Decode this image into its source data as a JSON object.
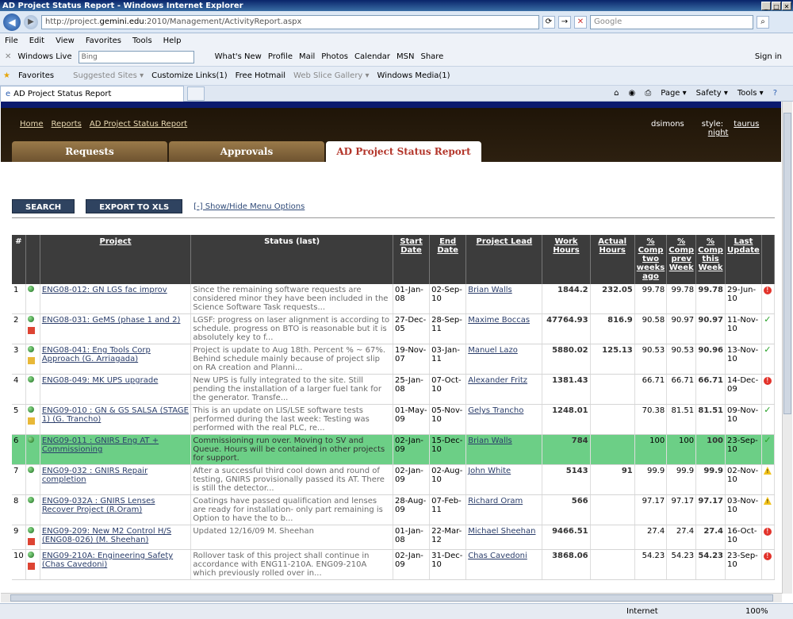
{
  "browser": {
    "title": "AD Project Status Report - Windows Internet Explorer",
    "url_prefix": "http://project.",
    "url_domain": "gemini.edu",
    "url_suffix": ":2010/Management/ActivityReport.aspx",
    "search_placeholder": "Google",
    "tab_title": "AD Project Status Report",
    "zone": "Internet",
    "zoom": "100%"
  },
  "menu": [
    "File",
    "Edit",
    "View",
    "Favorites",
    "Tools",
    "Help"
  ],
  "links": {
    "windows_live": "Windows Live",
    "bing": "Bing",
    "items": [
      "What's New",
      "Profile",
      "Mail",
      "Photos",
      "Calendar",
      "MSN",
      "Share"
    ],
    "signin": "Sign in"
  },
  "favorites": {
    "label": "Favorites",
    "items": [
      "Suggested Sites ▾",
      "Customize Links(1)",
      "Free Hotmail",
      "Web Slice Gallery ▾",
      "Windows Media(1)"
    ]
  },
  "commands": [
    "Page ▾",
    "Safety ▾",
    "Tools ▾"
  ],
  "page": {
    "breadcrumb": [
      "Home",
      "Reports",
      "AD Project Status Report"
    ],
    "user": "dsimons",
    "style_label": "style:",
    "styles": [
      "taurus",
      "night"
    ],
    "tabs": [
      "Requests",
      "Approvals",
      "AD Project Status Report"
    ],
    "search_btn": "SEARCH",
    "export_btn": "EXPORT TO XLS",
    "toggle": "[-] Show/Hide Menu Options"
  },
  "table": {
    "headers": [
      "#",
      "",
      "Project",
      "Status (last)",
      "Start Date",
      "End Date",
      "Project Lead",
      "Work Hours",
      "Actual Hours",
      "% Comp two weeks ago",
      "% Comp prev Week",
      "% Comp this Week",
      "Last Update",
      ""
    ],
    "rows": [
      {
        "n": "1",
        "cal": "",
        "project": "ENG08-012: GN LGS fac improv",
        "status": "Since the remaining software requests are considered minor they have been included in the Science Software Task requests...",
        "start": "01-Jan-08",
        "end": "02-Sep-10",
        "lead": "Brian Walls",
        "work": "1844.2",
        "actual": "232.05",
        "c2": "99.78",
        "cp": "99.78",
        "ct": "99.78",
        "upd": "29-Jun-10",
        "flag": "red",
        "hl": false
      },
      {
        "n": "2",
        "cal": "r",
        "project": "ENG08-031: GeMS (phase 1 and 2)",
        "status": "LGSF: progress on laser alignment is according to schedule. progress on BTO is reasonable but it is absolutely key to f...",
        "start": "27-Dec-05",
        "end": "28-Sep-11",
        "lead": "Maxime Boccas",
        "work": "47764.93",
        "actual": "816.9",
        "c2": "90.58",
        "cp": "90.97",
        "ct": "90.97",
        "upd": "11-Nov-10",
        "flag": "ok",
        "hl": false
      },
      {
        "n": "3",
        "cal": "y",
        "project": "ENG08-041: Eng Tools Corp Approach (G. Arriagada)",
        "status": "Project is update to Aug 18th. Percent % ~ 67%. Behind schedule mainly because of project slip on RA creation and Planni...",
        "start": "19-Nov-07",
        "end": "03-Jan-11",
        "lead": "Manuel Lazo",
        "work": "5880.02",
        "actual": "125.13",
        "c2": "90.53",
        "cp": "90.53",
        "ct": "90.96",
        "upd": "13-Nov-10",
        "flag": "ok",
        "hl": false
      },
      {
        "n": "4",
        "cal": "",
        "project": "ENG08-049: MK UPS upgrade",
        "status": "New UPS is fully integrated to the site. Still pending the installation of a larger fuel tank for the generator. Transfe...",
        "start": "25-Jan-08",
        "end": "07-Oct-10",
        "lead": "Alexander Fritz",
        "work": "1381.43",
        "actual": "",
        "c2": "66.71",
        "cp": "66.71",
        "ct": "66.71",
        "upd": "14-Dec-09",
        "flag": "red",
        "hl": false
      },
      {
        "n": "5",
        "cal": "y",
        "project": "ENG09-010 : GN & GS SALSA (STAGE 1) (G. Trancho)",
        "status": "This is an update on LIS/LSE software tests performed during the last week: Testing was performed with the real PLC, re...",
        "start": "01-May-09",
        "end": "05-Nov-10",
        "lead": "Gelys Trancho",
        "work": "1248.01",
        "actual": "",
        "c2": "70.38",
        "cp": "81.51",
        "ct": "81.51",
        "upd": "09-Nov-10",
        "flag": "ok",
        "hl": false
      },
      {
        "n": "6",
        "cal": "",
        "project": "ENG09-011 : GNIRS Eng AT + Commissioning",
        "status": "Commissioning run over. Moving to SV and Queue. Hours will be contained in other projects for support.",
        "start": "02-Jan-09",
        "end": "15-Dec-10",
        "lead": "Brian Walls",
        "work": "784",
        "actual": "",
        "c2": "100",
        "cp": "100",
        "ct": "100",
        "upd": "23-Sep-10",
        "flag": "ok",
        "hl": true
      },
      {
        "n": "7",
        "cal": "",
        "project": "ENG09-032 : GNIRS Repair completion",
        "status": "After a successful third cool down and round of testing, GNIRS provisionally passed its AT. There is still the detector...",
        "start": "02-Jan-09",
        "end": "02-Aug-10",
        "lead": "John White",
        "work": "5143",
        "actual": "91",
        "c2": "99.9",
        "cp": "99.9",
        "ct": "99.9",
        "upd": "02-Nov-10",
        "flag": "warn",
        "hl": false
      },
      {
        "n": "8",
        "cal": "",
        "project": "ENG09-032A : GNIRS Lenses Recover Project (R.Oram)",
        "status": "Coatings have passed qualification and lenses are ready for installation- only part remaining is Option to have the to b...",
        "start": "28-Aug-09",
        "end": "07-Feb-11",
        "lead": "Richard Oram",
        "work": "566",
        "actual": "",
        "c2": "97.17",
        "cp": "97.17",
        "ct": "97.17",
        "upd": "03-Nov-10",
        "flag": "warn",
        "hl": false
      },
      {
        "n": "9",
        "cal": "r",
        "project": "ENG09-209: New M2 Control H/S (ENG08-026) (M. Sheehan)",
        "status": "Updated 12/16/09 M. Sheehan",
        "start": "01-Jan-08",
        "end": "22-Mar-12",
        "lead": "Michael Sheehan",
        "work": "9466.51",
        "actual": "",
        "c2": "27.4",
        "cp": "27.4",
        "ct": "27.4",
        "upd": "16-Oct-10",
        "flag": "red",
        "hl": false
      },
      {
        "n": "10",
        "cal": "r",
        "project": "ENG09-210A: Engineering Safety (Chas Cavedoni)",
        "status": "Rollover task of this project shall continue in accordance with ENG11-210A. ENG09-210A which previously rolled over in...",
        "start": "02-Jan-09",
        "end": "31-Dec-10",
        "lead": "Chas Cavedoni",
        "work": "3868.06",
        "actual": "",
        "c2": "54.23",
        "cp": "54.23",
        "ct": "54.23",
        "upd": "23-Sep-10",
        "flag": "red",
        "hl": false
      }
    ]
  }
}
